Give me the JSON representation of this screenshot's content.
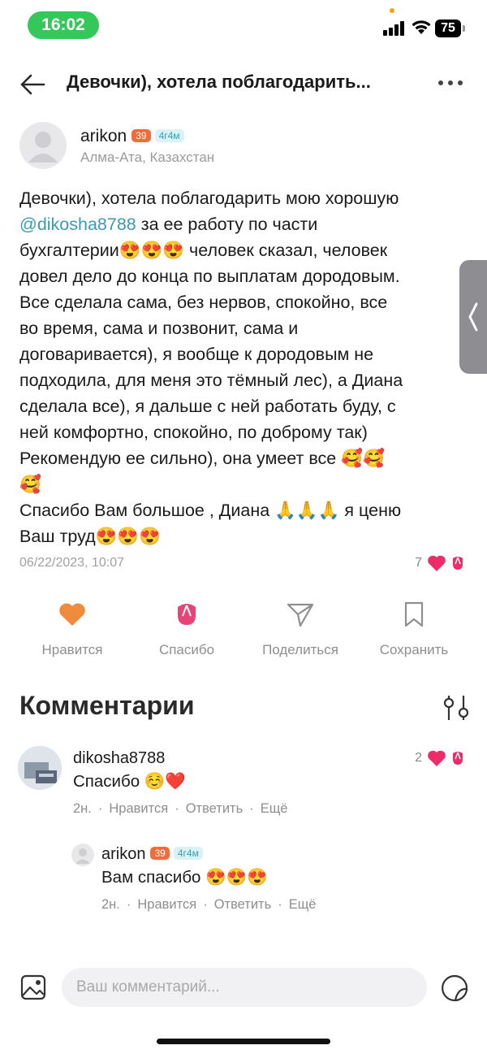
{
  "status_bar": {
    "time": "16:02",
    "battery": "75"
  },
  "header": {
    "title": "Девочки), хотела поблагодарить..."
  },
  "author": {
    "name": "arikon",
    "level_badge": "39",
    "age_badge": "4г4м",
    "location": "Алма-Ата, Казахстан"
  },
  "post": {
    "lines": [
      "Девочки), хотела поблагодарить мою хорошую",
      "@dikosha8788",
      " за ее работу по части",
      "бухгалтерии😍😍😍 человек сказал, человек",
      "довел дело до конца по выплатам дородовым.",
      "Все сделала сама, без нервов, спокойно, все",
      "во время, сама и позвонит, сама и",
      "договаривается), я вообще к дородовым не",
      "подходила, для меня это тёмный лес), а Диана",
      "сделала все), я дальше с ней работать буду, с",
      "ней комфортно, спокойно, по доброму так)",
      "Рекомендую ее сильно), она умеет все 🥰🥰",
      "🥰",
      "Спасибо Вам большое , Диана 🙏🙏🙏 я ценю",
      "Ваш труд😍😍😍"
    ],
    "date": "06/22/2023, 10:07",
    "reaction_count": "7"
  },
  "actions": {
    "like": "Нравится",
    "thanks": "Спасибо",
    "share": "Поделиться",
    "save": "Сохранить"
  },
  "comments_title": "Комментарии",
  "comment": {
    "name": "dikosha8788",
    "text": "Спасибо ☺️❤️",
    "time": "2н.",
    "like": "Нравится",
    "reply": "Ответить",
    "more": "Ещё",
    "reaction_count": "2"
  },
  "reply": {
    "name": "arikon",
    "level_badge": "39",
    "age_badge": "4г4м",
    "text": "Вам спасибо 😍😍😍",
    "time": "2н.",
    "like": "Нравится",
    "reply": "Ответить",
    "more": "Ещё"
  },
  "input": {
    "placeholder": "Ваш комментарий..."
  },
  "colors": {
    "accent_orange": "#f08a3c",
    "thanks_pink": "#e8447a",
    "heart_pink": "#ee2c6a",
    "mention": "#3a9bb5",
    "status_green": "#34c759"
  },
  "icons": [
    "back-arrow-icon",
    "more-icon",
    "heart-icon",
    "tulip-icon",
    "send-icon",
    "bookmark-icon",
    "filter-icon",
    "image-icon",
    "sticker-icon"
  ]
}
